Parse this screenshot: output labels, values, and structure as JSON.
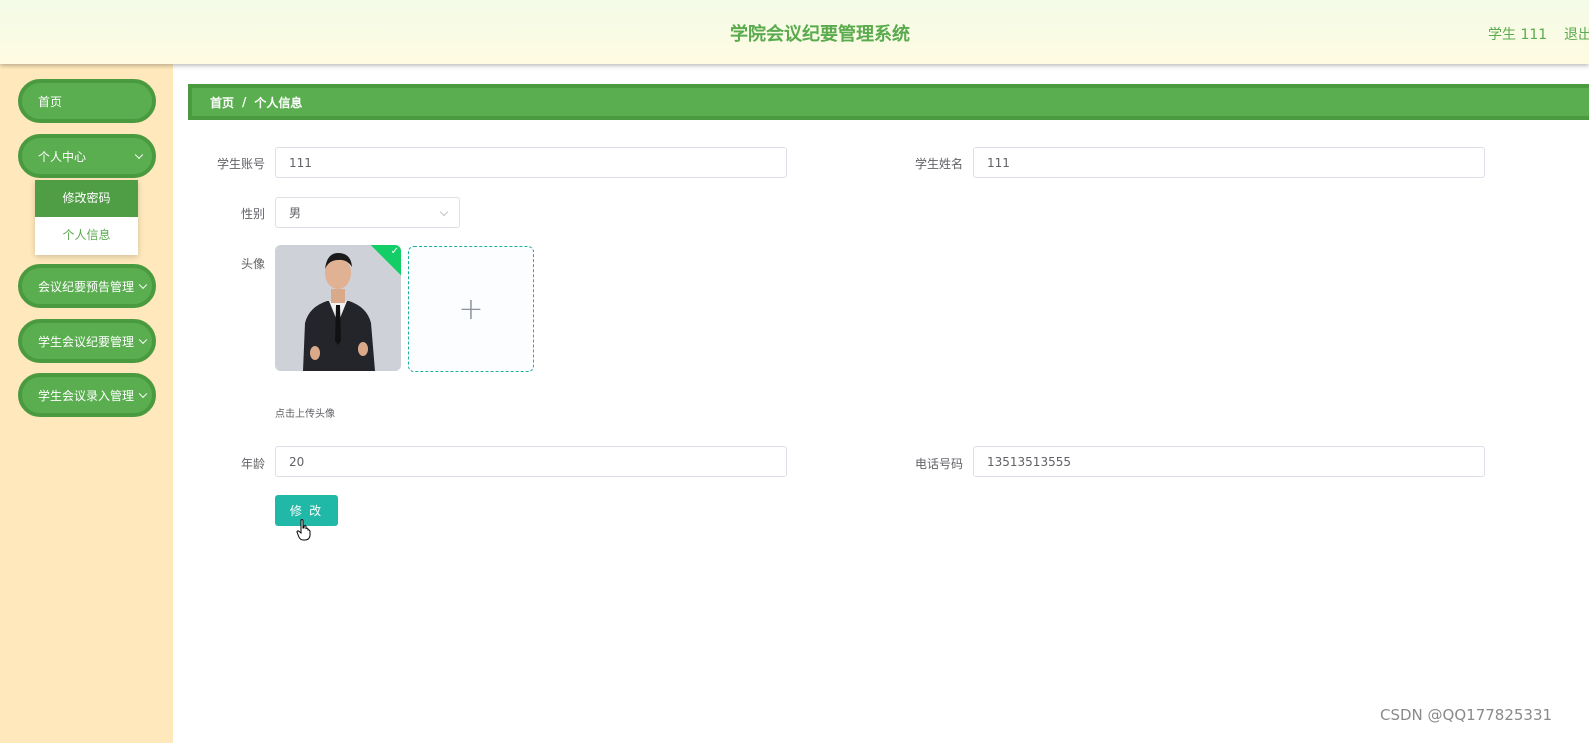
{
  "header": {
    "title": "学院会议纪要管理系统",
    "user": "学生 111",
    "logout": "退出"
  },
  "sidebar": {
    "items": [
      {
        "label": "首页",
        "has_chevron": false
      },
      {
        "label": "个人中心",
        "has_chevron": true
      },
      {
        "label": "会议纪要预告管理",
        "has_chevron": true
      },
      {
        "label": "学生会议纪要管理",
        "has_chevron": true
      },
      {
        "label": "学生会议录入管理",
        "has_chevron": true
      }
    ],
    "sub_items": [
      {
        "label": "修改密码",
        "active": true
      },
      {
        "label": "个人信息",
        "active": false
      }
    ]
  },
  "breadcrumb": {
    "home": "首页",
    "separator": "/",
    "current": "个人信息"
  },
  "form": {
    "account_label": "学生账号",
    "account_value": "111",
    "name_label": "学生姓名",
    "name_value": "111",
    "gender_label": "性别",
    "gender_value": "男",
    "avatar_label": "头像",
    "avatar_tip": "点击上传头像",
    "age_label": "年龄",
    "age_value": "20",
    "phone_label": "电话号码",
    "phone_value": "13513513555",
    "submit_label": "修 改"
  },
  "watermark": "CSDN @QQ177825331",
  "colors": {
    "brand_green": "#5aae50",
    "submit_teal": "#20b8a6",
    "sidebar_bg": "#ffe9bc"
  }
}
